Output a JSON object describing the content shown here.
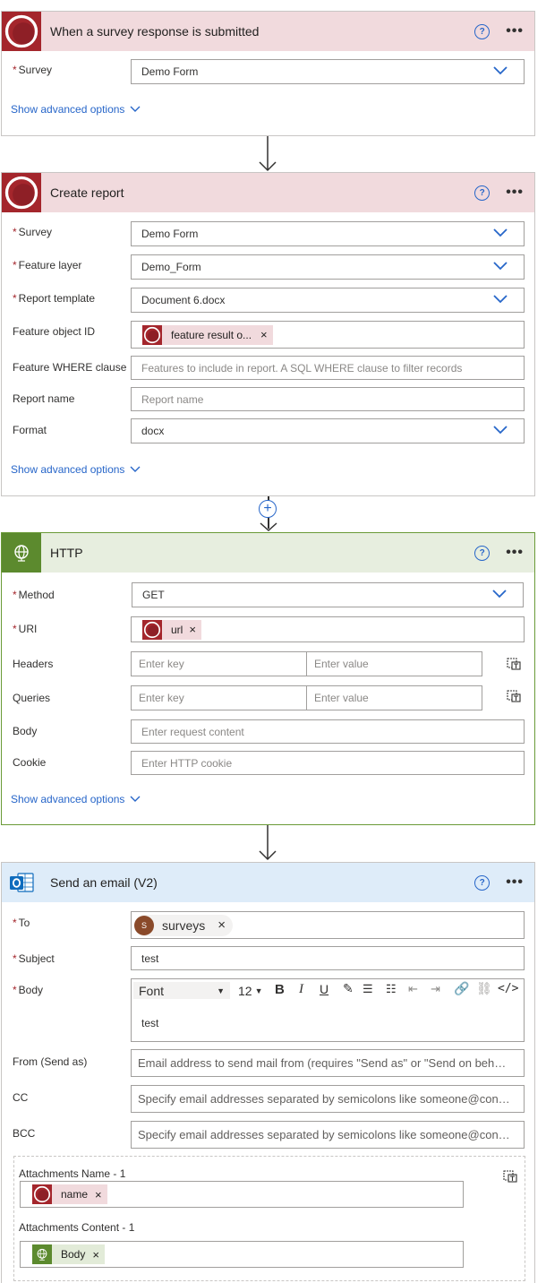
{
  "trigger": {
    "title": "When a survey response is submitted",
    "survey_label": "Survey",
    "survey_value": "Demo Form",
    "advanced": "Show advanced options"
  },
  "report": {
    "title": "Create report",
    "survey_label": "Survey",
    "survey_value": "Demo Form",
    "feature_layer_label": "Feature layer",
    "feature_layer_value": "Demo_Form",
    "template_label": "Report template",
    "template_value": "Document 6.docx",
    "object_id_label": "Feature object ID",
    "object_id_token": "feature result o...",
    "where_label": "Feature WHERE clause",
    "where_placeholder": "Features to include in report. A SQL WHERE clause to filter records",
    "name_label": "Report name",
    "name_placeholder": "Report name",
    "format_label": "Format",
    "format_value": "docx",
    "advanced": "Show advanced options"
  },
  "http": {
    "title": "HTTP",
    "method_label": "Method",
    "method_value": "GET",
    "uri_label": "URI",
    "uri_token": "url",
    "headers_label": "Headers",
    "queries_label": "Queries",
    "key_placeholder": "Enter key",
    "value_placeholder": "Enter value",
    "body_label": "Body",
    "body_placeholder": "Enter request content",
    "cookie_label": "Cookie",
    "cookie_placeholder": "Enter HTTP cookie",
    "advanced": "Show advanced options"
  },
  "email": {
    "title": "Send an email (V2)",
    "to_label": "To",
    "to_avatar": "S",
    "to_token": "surveys",
    "subject_label": "Subject",
    "subject_value": "test",
    "body_label": "Body",
    "font_value": "Font",
    "size_value": "12",
    "body_value": "test",
    "from_label": "From (Send as)",
    "from_placeholder": "Email address to send mail from (requires \"Send as\" or \"Send on beh…",
    "cc_label": "CC",
    "cc_placeholder": "Specify email addresses separated by semicolons like someone@con…",
    "bcc_label": "BCC",
    "bcc_placeholder": "Specify email addresses separated by semicolons like someone@con…",
    "att_name_label": "Attachments Name - 1",
    "att_name_token": "name",
    "att_content_label": "Attachments Content - 1",
    "att_content_token": "Body"
  },
  "colors": {
    "accent": "#2766c9",
    "survey_red": "#a4262c",
    "http_green": "#5c8a2e",
    "outlook_blue": "#0f6cbd"
  }
}
